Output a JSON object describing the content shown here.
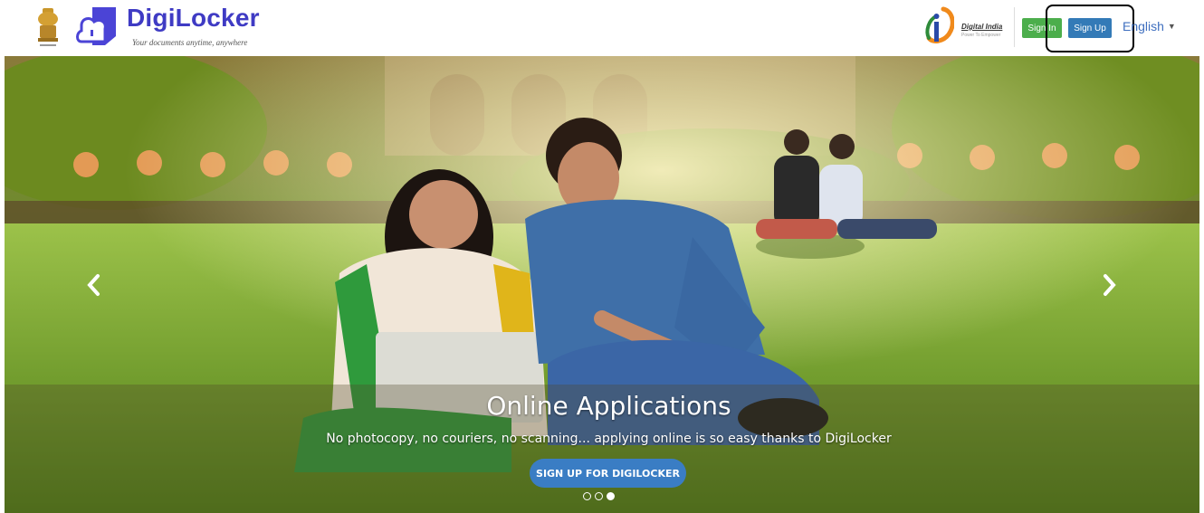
{
  "header": {
    "brand_name": "DigiLocker",
    "brand_tagline": "Your documents anytime, anywhere",
    "partner_name": "Digital India",
    "partner_tagline": "Power To Empower",
    "signin_label": "Sign In",
    "signup_label": "Sign Up",
    "language": "English",
    "colors": {
      "brand": "#3f3bc4",
      "signin": "#4cae4c",
      "signup": "#337ab7"
    }
  },
  "carousel": {
    "title": "Online Applications",
    "subtitle": "No photocopy, no couriers, no scanning... applying online is so easy thanks to DigiLocker",
    "cta_label": "SIGN UP FOR DIGILOCKER",
    "prev_icon": "chevron-left-icon",
    "next_icon": "chevron-right-icon",
    "slide_count": 3,
    "active_slide": 3
  }
}
